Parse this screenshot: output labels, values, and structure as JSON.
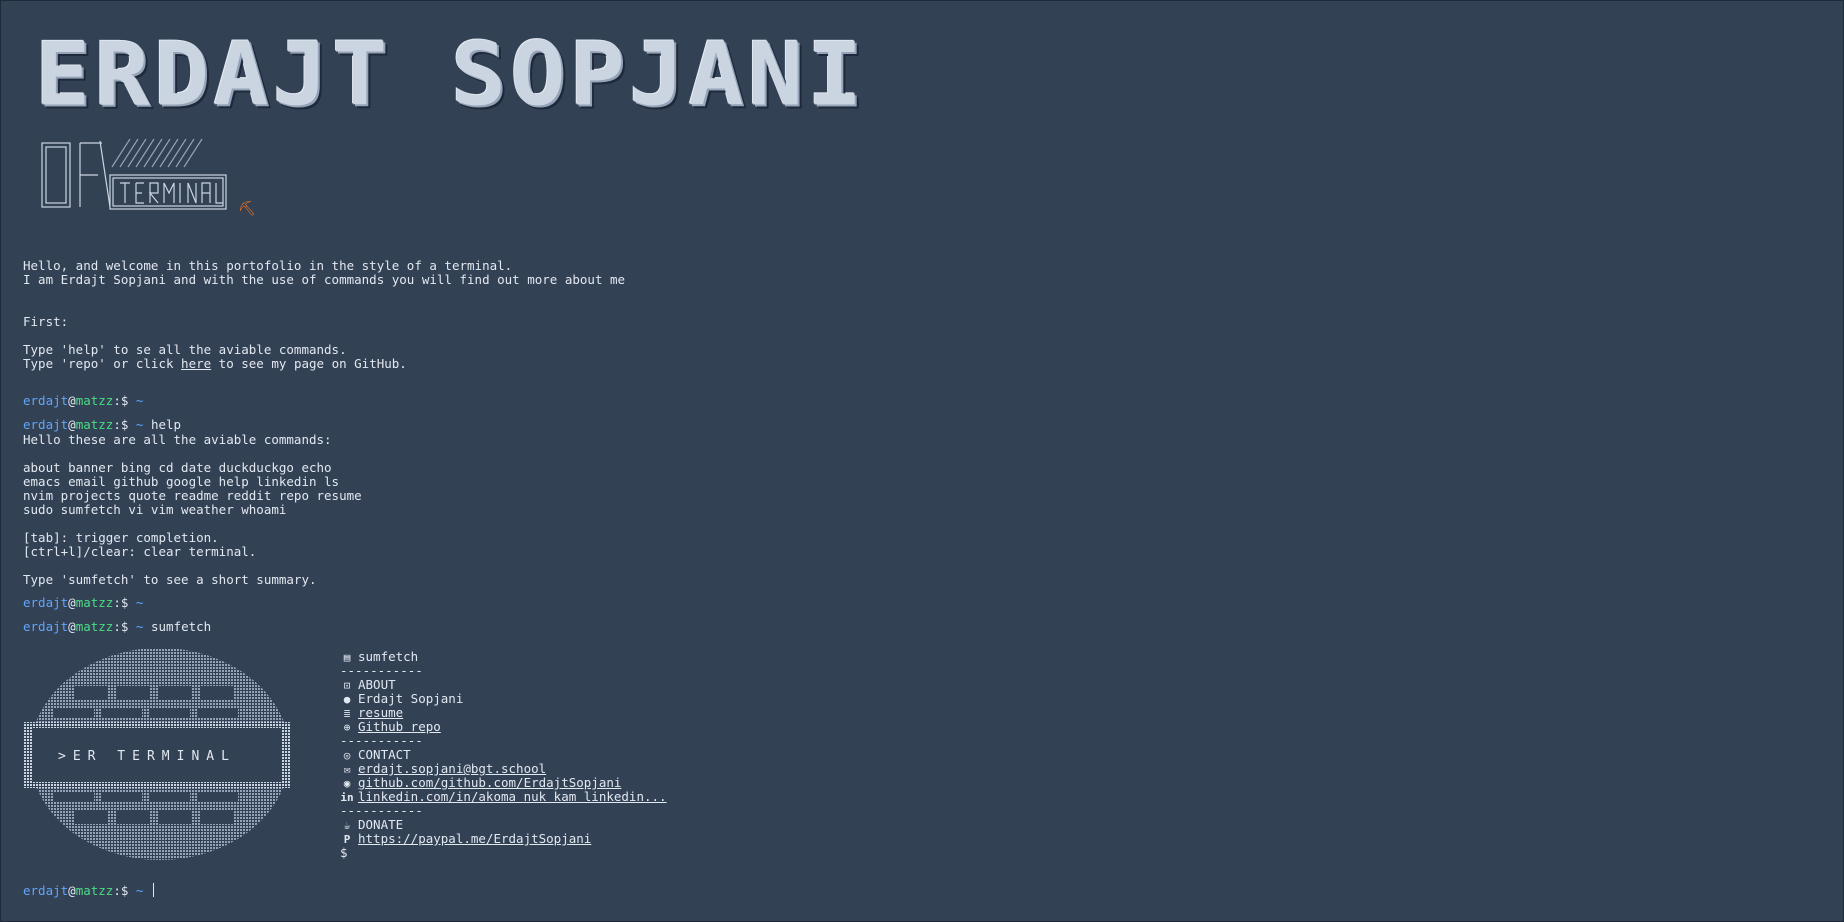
{
  "banner": {
    "title": "ERDAJT SOPJANI",
    "subtitle": "ER TERMINAL",
    "tool_icon": "pickaxe-icon"
  },
  "intro": {
    "line1": "Hello, and welcome in this portofolio in the style of a terminal.",
    "line2": "I am Erdajt Sopjani and with the use of commands you will find out more about me",
    "first": "First:",
    "help_hint": "Type 'help' to se all the aviable commands.",
    "repo_prefix": "Type 'repo' or click ",
    "repo_link": "here",
    "repo_suffix": " to see my page on GitHub."
  },
  "prompt": {
    "user": "erdajt",
    "at": "@",
    "host": "matzz",
    "sep": ":$",
    "path": "~"
  },
  "history": [
    {
      "command": ""
    },
    {
      "command": "help"
    },
    {
      "command": ""
    },
    {
      "command": "sumfetch"
    }
  ],
  "help_output": {
    "header": "Hello these are all the aviable commands:",
    "rows": [
      "about banner bing cd date duckduckgo echo",
      "emacs email github google help linkedin ls",
      "nvim projects quote readme reddit repo resume",
      "sudo sumfetch vi vim weather whoami"
    ],
    "tab": "[tab]: trigger completion.",
    "clear": "[ctrl+l]/clear: clear terminal.",
    "sumfetch_hint": "Type 'sumfetch' to see a short summary."
  },
  "sumfetch": {
    "logo_text": ">ER TERMINAL",
    "title": "sumfetch",
    "divider": "-----------",
    "about_label": "ABOUT",
    "name": "Erdajt Sopjani",
    "resume": "resume",
    "github_repo": "Github repo",
    "contact_label": "CONTACT",
    "email": "erdajt.sopjani@bgt.school",
    "github": "github.com/github.com/ErdajtSopjani",
    "linkedin": "linkedin.com/in/akoma nuk kam linkedin...",
    "donate_label": "DONATE",
    "paypal": "https://paypal.me/ErdajtSopjani",
    "dollar": "$"
  },
  "colors": {
    "background": "#334155",
    "text": "#e2e8f0",
    "user": "#60a5fa",
    "host": "#4ade80"
  }
}
